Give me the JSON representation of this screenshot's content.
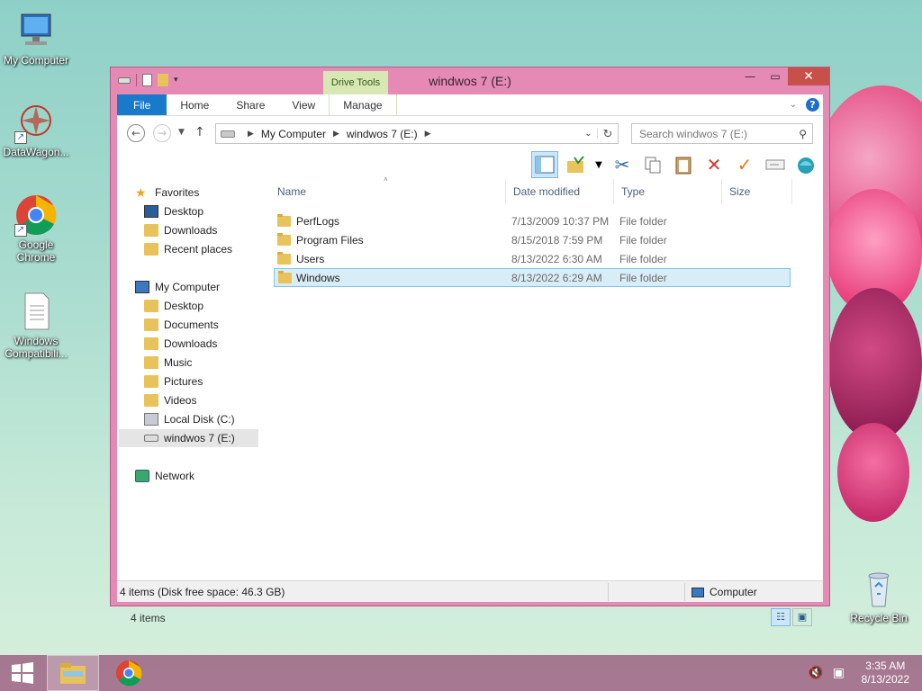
{
  "desktop": {
    "icons": [
      {
        "label": "My Computer"
      },
      {
        "label": "DataWagon..."
      },
      {
        "label": "Google Chrome"
      },
      {
        "label": "Windows Compatibili..."
      },
      {
        "label": "Recycle Bin"
      }
    ]
  },
  "window": {
    "title": "windwos 7 (E:)",
    "contextual_group": "Drive Tools",
    "tabs": [
      "File",
      "Home",
      "Share",
      "View",
      "Manage"
    ],
    "address": {
      "crumbs": [
        "My Computer",
        "windwos 7 (E:)"
      ]
    },
    "search_placeholder": "Search windwos 7 (E:)",
    "nav": {
      "favorites_header": "Favorites",
      "favorites": [
        "Desktop",
        "Downloads",
        "Recent places"
      ],
      "computer_header": "My Computer",
      "computer": [
        "Desktop",
        "Documents",
        "Downloads",
        "Music",
        "Pictures",
        "Videos",
        "Local Disk (C:)",
        "windwos 7 (E:)"
      ],
      "network": "Network"
    },
    "columns": [
      "Name",
      "Date modified",
      "Type",
      "Size"
    ],
    "files": [
      {
        "name": "PerfLogs",
        "date": "7/13/2009 10:37 PM",
        "type": "File folder",
        "size": ""
      },
      {
        "name": "Program Files",
        "date": "8/15/2018 7:59 PM",
        "type": "File folder",
        "size": ""
      },
      {
        "name": "Users",
        "date": "8/13/2022 6:30 AM",
        "type": "File folder",
        "size": ""
      },
      {
        "name": "Windows",
        "date": "8/13/2022 6:29 AM",
        "type": "File folder",
        "size": ""
      }
    ],
    "item_count": "4 items",
    "status_left": "4 items (Disk free space: 46.3 GB)",
    "status_right": "Computer"
  },
  "taskbar": {
    "time": "3:35 AM",
    "date": "8/13/2022"
  }
}
